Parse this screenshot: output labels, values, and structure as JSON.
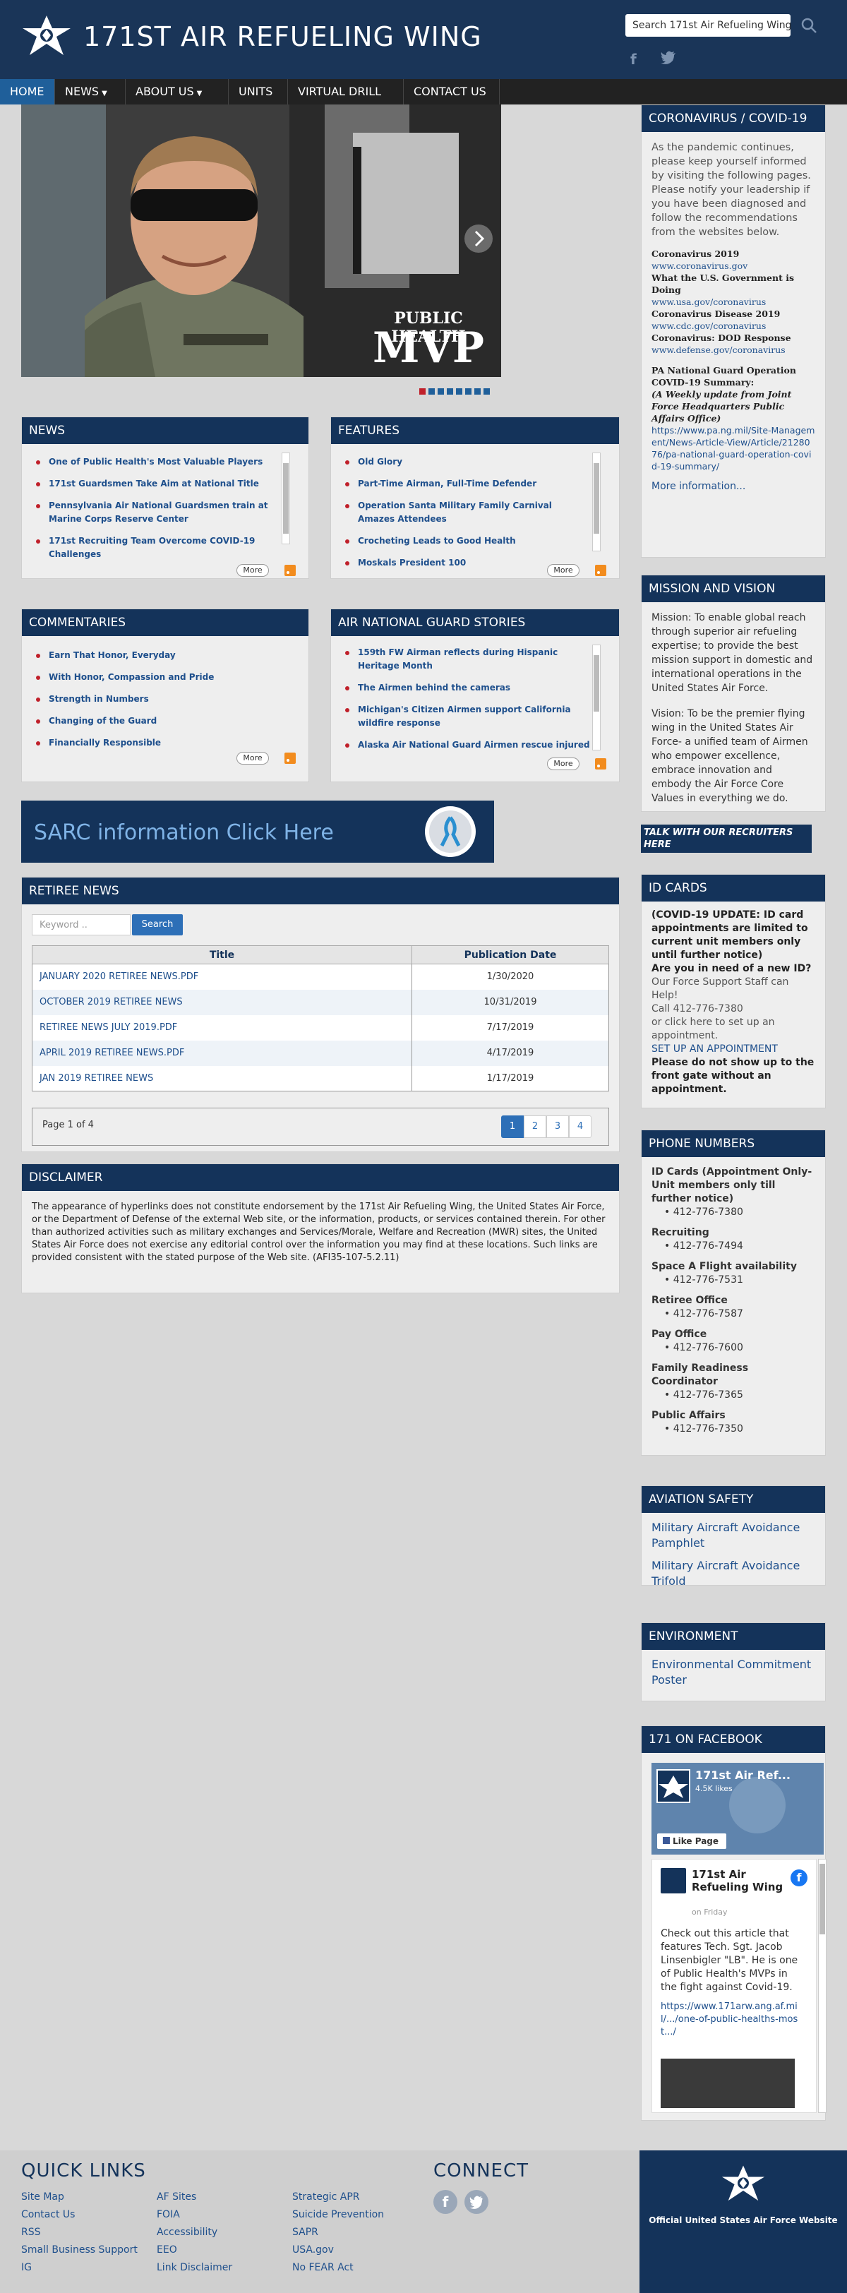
{
  "header": {
    "title": "171ST AIR REFUELING WING",
    "search_placeholder": "Search 171st Air Refueling Wing"
  },
  "nav": {
    "items": [
      "HOME",
      "NEWS",
      "ABOUT US",
      "UNITS",
      "VIRTUAL DRILL",
      "CONTACT US"
    ]
  },
  "hero": {
    "overlay_line1": "PUBLIC HEALTH",
    "overlay_line2": "MVP"
  },
  "news": {
    "title": "NEWS",
    "items": [
      "One of Public Health's Most Valuable Players",
      "171st Guardsmen Take Aim at National Title",
      "Pennsylvania Air National Guardsmen train at Marine Corps Reserve Center",
      "171st Recruiting Team Overcome COVID-19 Challenges"
    ],
    "more": "More"
  },
  "features": {
    "title": "FEATURES",
    "items": [
      "Old Glory",
      "Part-Time Airman, Full-Time Defender",
      "Operation Santa Military Family Carnival Amazes Attendees",
      "Crocheting Leads to Good Health",
      "Moskals President 100"
    ],
    "more": "More"
  },
  "commentaries": {
    "title": "COMMENTARIES",
    "items": [
      "Earn That Honor, Everyday",
      "With Honor, Compassion and Pride",
      "Strength in Numbers",
      "Changing of the Guard",
      "Financially Responsible"
    ],
    "more": "More"
  },
  "ang_stories": {
    "title": "AIR NATIONAL GUARD STORIES",
    "items": [
      "159th FW Airman reflects during Hispanic Heritage Month",
      "The Airmen behind the cameras",
      "Michigan's Citizen Airmen support California wildfire response",
      "Alaska Air National Guard Airmen rescue injured"
    ],
    "more": "More"
  },
  "sarc": {
    "text": "SARC information Click Here"
  },
  "retiree": {
    "title": "RETIREE NEWS",
    "keyword_placeholder": "Keyword ..",
    "search_label": "Search",
    "columns": [
      "Title",
      "Publication Date"
    ],
    "rows": [
      {
        "title": "JANUARY 2020 RETIREE NEWS.PDF",
        "date": "1/30/2020"
      },
      {
        "title": "OCTOBER 2019 RETIREE NEWS",
        "date": "10/31/2019"
      },
      {
        "title": "RETIREE NEWS JULY 2019.PDF",
        "date": "7/17/2019"
      },
      {
        "title": "APRIL 2019 RETIREE NEWS.PDF",
        "date": "4/17/2019"
      },
      {
        "title": "JAN 2019 RETIREE NEWS",
        "date": "1/17/2019"
      }
    ],
    "page_info": "Page 1 of 4",
    "pages": [
      "1",
      "2",
      "3",
      "4"
    ]
  },
  "disclaimer": {
    "title": "DISCLAIMER",
    "text": "The appearance of hyperlinks does not constitute endorsement by the 171st Air Refueling Wing, the United States Air Force, or the Department of Defense of the external Web site, or the information, products, or services contained therein. For other than authorized activities such as military exchanges and Services/Morale, Welfare and Recreation (MWR) sites, the United States Air Force does not exercise any editorial control over the information you may find at these locations. Such links are provided consistent with the stated purpose of the Web site. (AFI35-107-5.2.11)"
  },
  "covid": {
    "title": "CORONAVIRUS / COVID-19",
    "intro": "As the pandemic continues, please keep yourself informed by visiting the following pages. Please notify your leadership if you have been diagnosed and follow the recommendations from the websites below.",
    "links": [
      {
        "label": "Coronavirus 2019",
        "url": "www.coronavirus.gov"
      },
      {
        "label": "What the U.S. Government is Doing",
        "url": "www.usa.gov/coronavirus"
      },
      {
        "label": "Coronavirus Disease 2019",
        "url": "www.cdc.gov/coronavirus"
      },
      {
        "label": "Coronavirus: DOD Response",
        "url": "www.defense.gov/coronavirus"
      }
    ],
    "pa_title": "PA National Guard Operation COVID-19 Summary:",
    "pa_note": "(A Weekly update from Joint Force Headquarters Public Affairs Office)",
    "pa_url": "https://www.pa.ng.mil/Site-Management/News-Article-View/Article/2128076/pa-national-guard-operation-covid-19-summary/",
    "more": "More information..."
  },
  "mission": {
    "title": "MISSION AND VISION",
    "mission": "Mission: To enable global reach through superior air refueling expertise; to provide the best mission support in domestic and international operations in the United States Air Force.",
    "vision": "Vision: To be the premier flying wing in the United States Air Force- a unified team of Airmen who empower excellence, embrace innovation and embody the Air Force Core Values in everything we do."
  },
  "recruiters": {
    "text": "TALK WITH OUR RECRUITERS HERE"
  },
  "id_cards": {
    "title": "ID CARDS",
    "update": "(COVID-19 UPDATE: ID card appointments are limited to current unit members only until further notice)",
    "question": "Are you in need of a new ID?",
    "help": "Our Force Support Staff can Help!",
    "call": "Call 412-776-7380",
    "or_click": "or click here to set up an appointment.",
    "setup_link": "SET UP AN APPOINTMENT",
    "warning": "Please do not show up to the front gate without an appointment."
  },
  "phones": {
    "title": "PHONE NUMBERS",
    "entries": [
      {
        "label": "ID Cards (Appointment Only- Unit members only till further notice)",
        "number": "412-776-7380"
      },
      {
        "label": "Recruiting",
        "number": "412-776-7494"
      },
      {
        "label": "Space A Flight availability",
        "number": "412-776-7531"
      },
      {
        "label": "Retiree Office",
        "number": "412-776-7587"
      },
      {
        "label": "Pay Office",
        "number": "412-776-7600"
      },
      {
        "label": "Family Readiness Coordinator",
        "number": "412-776-7365"
      },
      {
        "label": "Public Affairs",
        "number": "412-776-7350"
      }
    ]
  },
  "aviation": {
    "title": "AVIATION SAFETY",
    "links": [
      "Military Aircraft Avoidance Pamphlet",
      "Military Aircraft Avoidance Trifold"
    ]
  },
  "environment": {
    "title": "ENVIRONMENT",
    "link": "Environmental Commitment Poster"
  },
  "facebook": {
    "title": "171 ON FACEBOOK",
    "page_name": "171st Air Ref...",
    "likes": "4.5K likes",
    "like_label": "Like Page",
    "post_name": "171st Air Refueling Wing",
    "post_time": "on Friday",
    "post_text": "Check out this article that features Tech. Sgt. Jacob Linsenbigler \"LB\". He is one of Public Health's MVPs in the fight against Covid-19.",
    "post_link": "https://www.171arw.ang.af.mil/.../one-of-public-healths-most.../"
  },
  "footer": {
    "quick_links_title": "QUICK LINKS",
    "col1": [
      "Site Map",
      "Contact Us",
      "RSS",
      "Small Business Support",
      "IG"
    ],
    "col2": [
      "AF Sites",
      "FOIA",
      "Accessibility",
      "EEO",
      "Link Disclaimer"
    ],
    "col3": [
      "Strategic APR",
      "Suicide Prevention",
      "SAPR",
      "USA.gov",
      "No FEAR Act"
    ],
    "connect_title": "CONNECT",
    "official": "Official United States Air Force Website"
  },
  "colors": {
    "navy": "#14335a",
    "accent_red": "#c0202a",
    "link_blue": "#1e4f8c"
  }
}
